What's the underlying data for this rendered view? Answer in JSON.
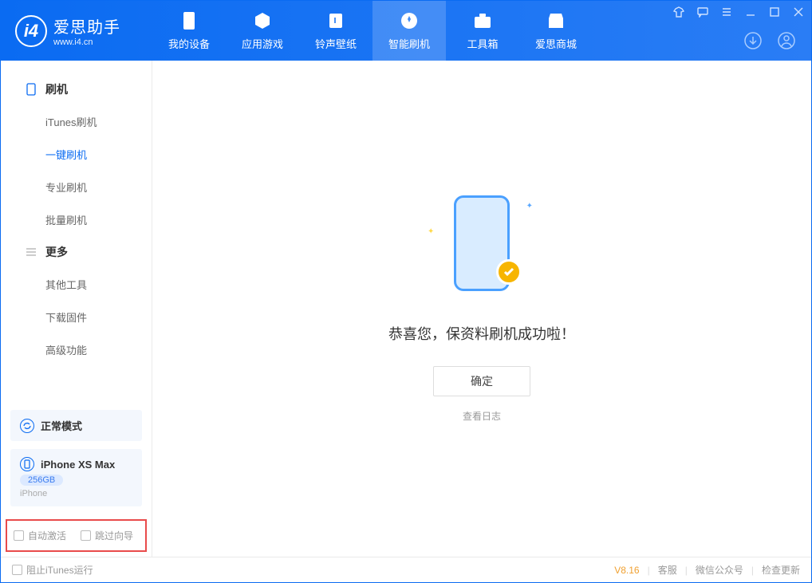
{
  "app": {
    "name_cn": "爱思助手",
    "url": "www.i4.cn"
  },
  "tabs": [
    {
      "label": "我的设备",
      "icon": "device"
    },
    {
      "label": "应用游戏",
      "icon": "cube"
    },
    {
      "label": "铃声壁纸",
      "icon": "music"
    },
    {
      "label": "智能刷机",
      "icon": "gear",
      "active": true
    },
    {
      "label": "工具箱",
      "icon": "toolbox"
    },
    {
      "label": "爱思商城",
      "icon": "store"
    }
  ],
  "sidebar": {
    "group1": {
      "title": "刷机",
      "items": [
        "iTunes刷机",
        "一键刷机",
        "专业刷机",
        "批量刷机"
      ],
      "active_index": 1
    },
    "group2": {
      "title": "更多",
      "items": [
        "其他工具",
        "下载固件",
        "高级功能"
      ]
    }
  },
  "mode_card": {
    "label": "正常模式"
  },
  "device_card": {
    "name": "iPhone XS Max",
    "capacity": "256GB",
    "type": "iPhone"
  },
  "bottom_opts": {
    "opt1": "自动激活",
    "opt2": "跳过向导"
  },
  "main": {
    "message": "恭喜您，保资料刷机成功啦！",
    "ok": "确定",
    "view_log": "查看日志"
  },
  "status": {
    "block_itunes": "阻止iTunes运行",
    "version": "V8.16",
    "links": [
      "客服",
      "微信公众号",
      "检查更新"
    ]
  }
}
